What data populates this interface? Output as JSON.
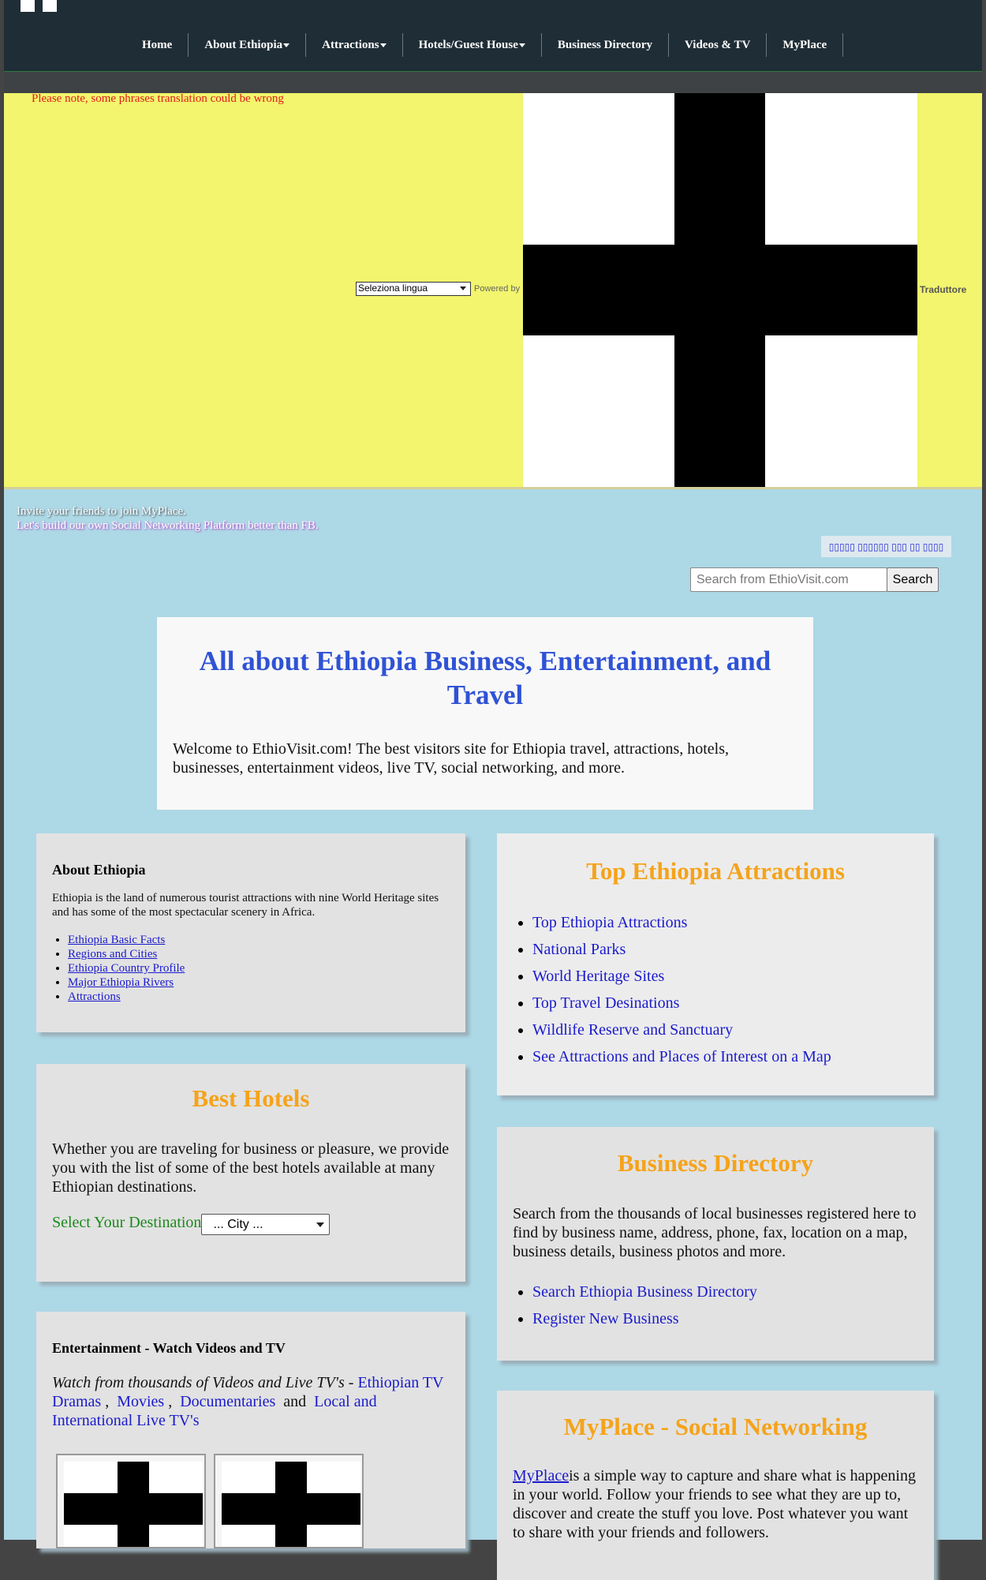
{
  "nav": {
    "items": [
      {
        "label": "Home",
        "dropdown": false
      },
      {
        "label": "About Ethiopia",
        "dropdown": true
      },
      {
        "label": "Attractions",
        "dropdown": true
      },
      {
        "label": "Hotels/Guest House",
        "dropdown": true
      },
      {
        "label": "Business Directory",
        "dropdown": false
      },
      {
        "label": "Videos & TV",
        "dropdown": false
      },
      {
        "label": "MyPlace",
        "dropdown": false
      }
    ]
  },
  "translate": {
    "note": "Please note, some phrases translation could be wrong",
    "select_value": "Seleziona lingua",
    "powered_by": "Powered by",
    "translator_label": "Traduttore"
  },
  "invite": {
    "line1": "Invite your friends to join MyPlace.",
    "line2": "Let's build our own Social Networking Platform better than FB."
  },
  "amharic_button": "▯▯▯▯▯ ▯▯▯▯▯▯ ▯▯▯ ▯▯ ▯▯▯▯",
  "search": {
    "placeholder": "Search from EthioVisit.com",
    "button": "Search"
  },
  "hero": {
    "title": "All about Ethiopia Business, Entertainment, and Travel",
    "text": "Welcome to EthioVisit.com! The best visitors site for Ethiopia travel, attractions, hotels, businesses, entertainment videos, live TV, social networking, and more."
  },
  "about": {
    "heading": "About Ethiopia",
    "text": "Ethiopia is the land of numerous tourist attractions with nine World Heritage sites and has some of the most spectacular scenery in Africa.",
    "links": [
      "Ethiopia Basic Facts",
      "Regions and Cities",
      "Ethiopia Country Profile",
      "Major Ethiopia Rivers",
      "Attractions"
    ]
  },
  "hotels": {
    "title": "Best Hotels",
    "text": "Whether you are traveling for business or pleasure, we provide you with the list of some of the best hotels available at many Ethiopian destinations.",
    "select_label": "Select Your Destination",
    "select_value": "... City ..."
  },
  "entertainment": {
    "heading": "Entertainment - Watch Videos and TV",
    "intro": "Watch from thousands of Videos and Live TV's",
    "dash": " - ",
    "links": [
      "Ethiopian TV Dramas",
      "Movies",
      "Documentaries",
      "Local and International Live TV's"
    ],
    "and": "and"
  },
  "attractions": {
    "title": "Top Ethiopia Attractions",
    "links": [
      "Top Ethiopia Attractions",
      "National Parks",
      "World Heritage Sites",
      "Top Travel Desinations",
      "Wildlife Reserve and Sanctuary",
      "See Attractions and Places of Interest on a Map"
    ]
  },
  "business": {
    "title": "Business Directory",
    "text": "Search from the thousands of local businesses registered here to find by business name, address, phone, fax, location on a map, business details, business photos and more.",
    "links": [
      "Search Ethiopia Business Directory",
      "Register New Business"
    ]
  },
  "myplace": {
    "title": "MyPlace - Social Networking",
    "link": "MyPlace",
    "text": "is a simple way to capture and share what is happening in your world. Follow your friends to see what they are up to, discover and create the stuff you love. Post whatever you want to share with your friends and followers."
  },
  "colors": {
    "nav_bg": "#1f2d36",
    "translate_bg": "#f2f56d",
    "page_bg": "#add8e6",
    "hero_title": "#2f52d5",
    "panel_title": "#f5a31a",
    "link": "#1a1acd",
    "note_red": "#e21b1b"
  },
  "icons": {
    "broken_image": "missing-image-placeholder-icon",
    "caret": "caret-down-icon"
  }
}
